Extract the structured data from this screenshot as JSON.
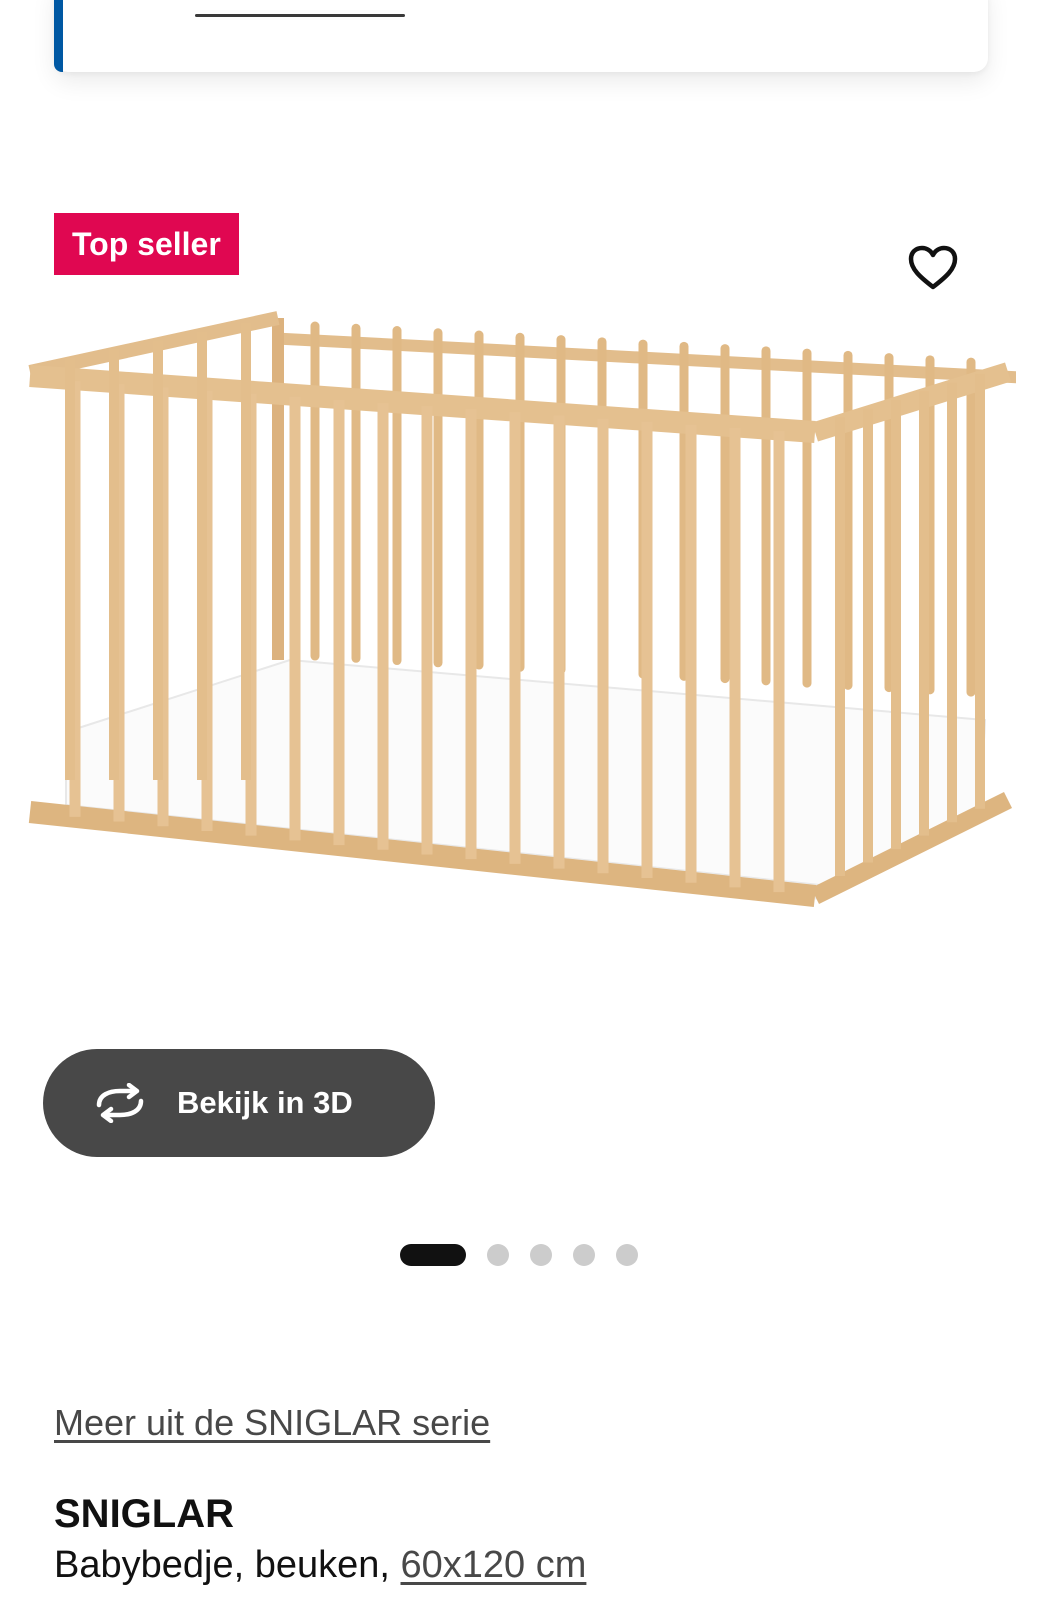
{
  "badge": {
    "label": "Top seller",
    "color": "#e00751"
  },
  "favorite": {
    "icon": "heart-outline-icon"
  },
  "view_3d": {
    "label": "Bekijk in 3D",
    "icon": "rotate-3d-icon"
  },
  "carousel": {
    "total": 5,
    "active_index": 0
  },
  "series_link": {
    "label": "Meer uit de SNIGLAR serie"
  },
  "product": {
    "name": "SNIGLAR",
    "description": "Babybedje, beuken,",
    "size": "60x120 cm",
    "image": "crib-image"
  },
  "colors": {
    "accent_blue": "#0058a3",
    "button_dark": "#484848",
    "wood": "#e7c496"
  }
}
